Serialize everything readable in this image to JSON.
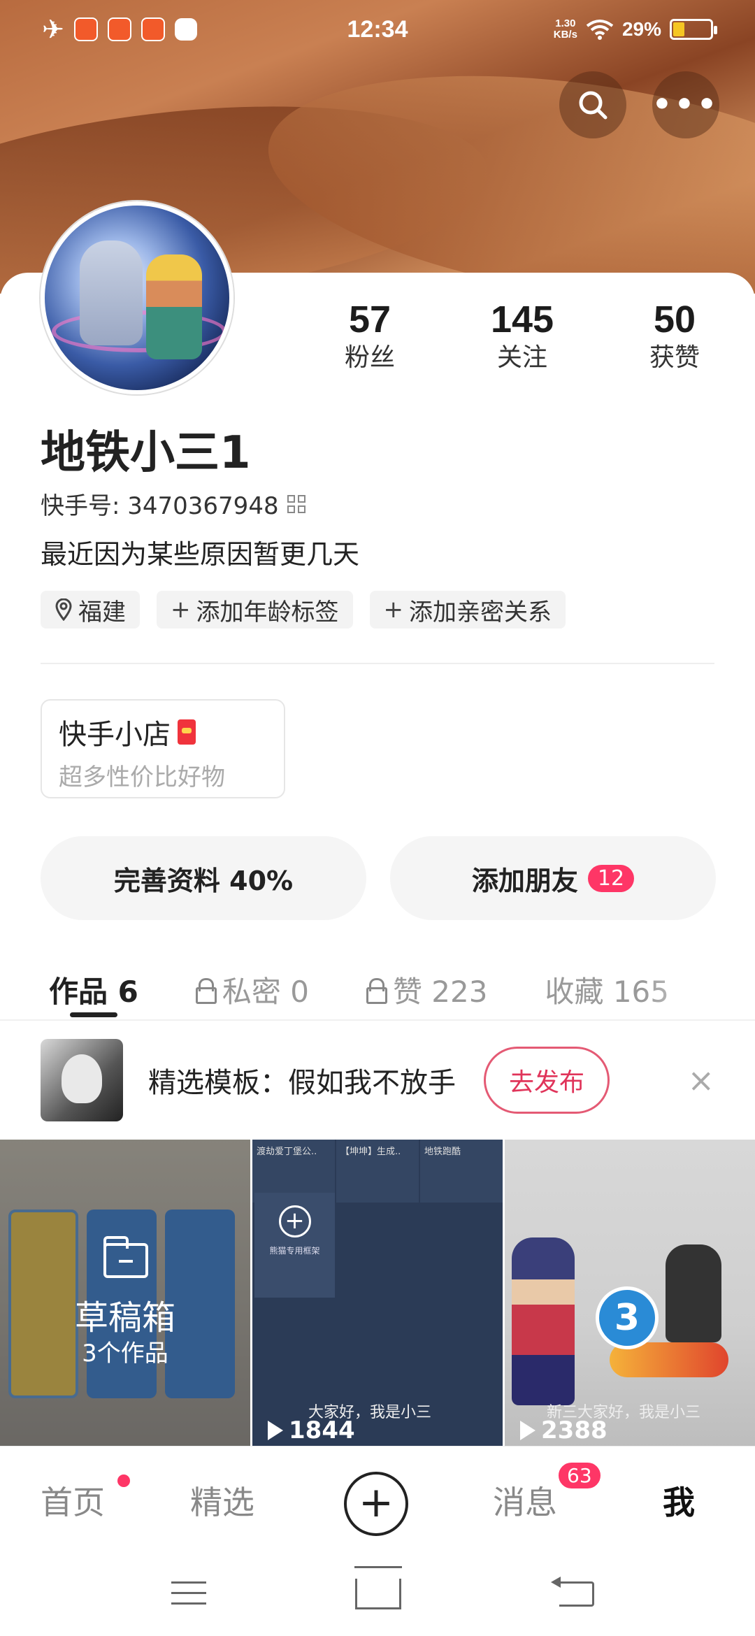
{
  "status_bar": {
    "time": "12:34",
    "net_speed_value": "1.30",
    "net_speed_unit": "KB/s",
    "battery": "29%",
    "battery_level": 0.29
  },
  "profile": {
    "fans_count": "57",
    "fans_label": "粉丝",
    "following_count": "145",
    "following_label": "关注",
    "likes_count": "50",
    "likes_label": "获赞",
    "username": "地铁小三1",
    "kuaishou_id": "快手号: 3470367948",
    "bio": "最近因为某些原因暂更几天"
  },
  "tags": {
    "location": "福建",
    "add_age": "添加年龄标签",
    "add_relation": "添加亲密关系"
  },
  "shop": {
    "title": "快手小店",
    "subtitle": "超多性价比好物"
  },
  "actions": {
    "complete_profile": "完善资料 40%",
    "add_friends": "添加朋友",
    "add_friends_badge": "12"
  },
  "tabs": [
    {
      "label": "作品 6"
    },
    {
      "label": "私密 0"
    },
    {
      "label": "赞 223"
    },
    {
      "label": "收藏 165"
    }
  ],
  "template_bar": {
    "text": "精选模板：假如我不放手",
    "publish": "去发布",
    "close": "×"
  },
  "grid": {
    "draft_title": "草稿箱",
    "draft_count": "3个作品",
    "cell2_mini1": "渡劫爱丁堡公..",
    "cell2_mini2": "【坤坤】生成..",
    "cell2_mini3": "地铁跑酷",
    "cell2_plus_caption": "熊猫专用框架",
    "cell2_caption": "大家好，我是小三",
    "cell2_plays": "1844",
    "cell3_caption": "新三大家好，我是小三",
    "cell3_plays": "2388",
    "cell3_number": "3"
  },
  "bottom_nav": {
    "home": "首页",
    "featured": "精选",
    "plus": "+",
    "messages": "消息",
    "messages_badge": "63",
    "me": "我"
  }
}
